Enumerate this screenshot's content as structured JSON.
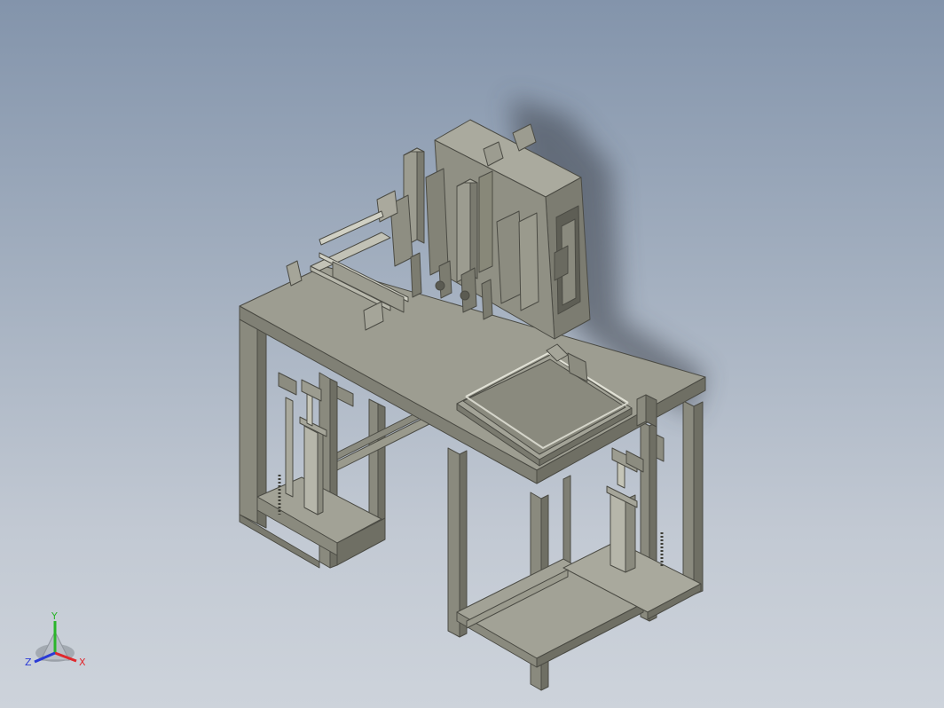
{
  "viewport": {
    "background_top": "#8394ab",
    "background_bottom": "#cdd3db",
    "model_color": "#9a9a8d",
    "model_dark": "#6f6f64",
    "model_light": "#b2b2a6"
  },
  "triad": {
    "x_label": "X",
    "y_label": "Y",
    "z_label": "Z",
    "x_color": "#e0282d",
    "y_color": "#2ab52a",
    "z_color": "#2a3ad6"
  }
}
